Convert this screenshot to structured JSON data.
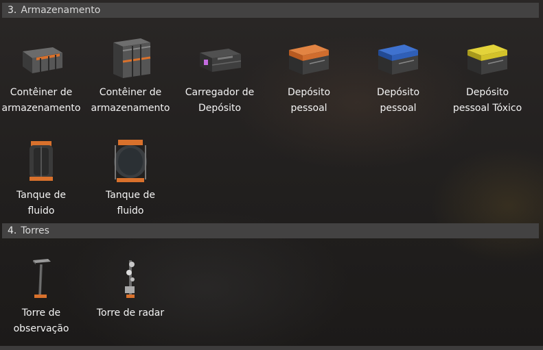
{
  "sections": [
    {
      "number": "3.",
      "title": "Armazenamento",
      "items": [
        {
          "label": "Contêiner de\narmazenamento",
          "icon": "storage-container-small-icon"
        },
        {
          "label": "Contêiner de\narmazenamento",
          "icon": "storage-container-large-icon"
        },
        {
          "label": "Carregador de\nDepósito",
          "icon": "depot-loader-icon"
        },
        {
          "label": "Depósito\npessoal",
          "icon": "orange-personal-box-icon"
        },
        {
          "label": "Depósito\npessoal",
          "icon": "blue-personal-box-icon"
        },
        {
          "label": "Depósito\npessoal Tóxico",
          "icon": "yellow-toxic-box-icon"
        },
        {
          "label": "Tanque de\nfluido",
          "icon": "fluid-tank-small-icon"
        },
        {
          "label": "Tanque de\nfluido",
          "icon": "fluid-tank-large-icon"
        }
      ]
    },
    {
      "number": "4.",
      "title": "Torres",
      "items": [
        {
          "label": "Torre de\nobservação",
          "icon": "lookout-tower-icon"
        },
        {
          "label": "Torre de radar",
          "icon": "radar-tower-icon"
        }
      ]
    }
  ],
  "colors": {
    "orange": "#d9712c",
    "blue": "#2f5fb8",
    "yellow": "#d3c22a",
    "header": "#434242"
  }
}
